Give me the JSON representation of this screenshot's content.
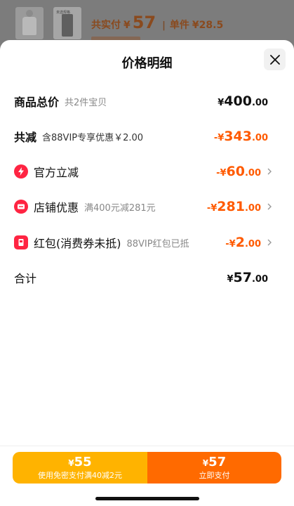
{
  "backdrop": {
    "thumb_tag": "未选规格",
    "total_label": "共实付",
    "currency": "¥",
    "total_value": "57",
    "separator": "|",
    "unit_label": "单件",
    "unit_price": "¥28.5"
  },
  "sheet": {
    "title": "价格明细",
    "close_icon": "close-icon"
  },
  "rows": {
    "goods": {
      "label": "商品总价",
      "sub": "共2件宝贝",
      "cur": "¥",
      "int": "400",
      "dec": ".00"
    },
    "discount": {
      "label": "共减",
      "sub": "含88VIP专享优惠￥2.00",
      "cur": "-¥",
      "int": "343",
      "dec": ".00"
    },
    "official": {
      "label": "官方立减",
      "sub": "",
      "cur": "-¥",
      "int": "60",
      "dec": ".00",
      "icon": "lightning-icon"
    },
    "store": {
      "label": "店铺优惠",
      "sub": "满400元减281元",
      "cur": "-¥",
      "int": "281",
      "dec": ".00",
      "icon": "coupon-icon"
    },
    "redpacket": {
      "label": "红包(消费券未抵)",
      "sub": "88VIP红包已抵",
      "cur": "-¥",
      "int": "2",
      "dec": ".00",
      "icon": "red-packet-icon"
    },
    "total": {
      "label": "合计",
      "cur": "¥",
      "int": "57",
      "dec": ".00"
    }
  },
  "footer": {
    "left": {
      "cur": "¥",
      "price": "55",
      "sub": "使用免密支付满40减2元"
    },
    "right": {
      "cur": "¥",
      "price": "57",
      "sub": "立即支付"
    }
  },
  "colors": {
    "accent_orange": "#ff5a00",
    "btn_yellow": "#ffb300",
    "btn_orange": "#ff6a00",
    "icon_red": "#ff2442"
  }
}
